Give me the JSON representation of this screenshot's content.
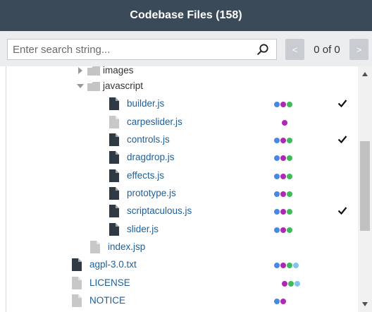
{
  "header": {
    "title": "Codebase Files (158)"
  },
  "search": {
    "placeholder": "Enter search string...",
    "value": "",
    "prev_label": "<",
    "next_label": ">",
    "match_count": "0 of 0"
  },
  "colors": {
    "header_bg": "#3b4a58",
    "blue": "#4a86e8",
    "purple": "#b026b8",
    "green": "#3fba5a",
    "lightblue": "#7ec4ef",
    "file_dark": "#2f3a45",
    "file_light": "#c8c8c8"
  },
  "tree": {
    "rows": [
      {
        "name": "images",
        "kind": "folder",
        "depth": 1,
        "toggle": "collapsed",
        "dots": [],
        "checked": false
      },
      {
        "name": "javascript",
        "kind": "folder",
        "depth": 1,
        "toggle": "expanded",
        "dots": [],
        "checked": false
      },
      {
        "name": "builder.js",
        "kind": "file",
        "depth": 2,
        "icon": "file-dark",
        "dots": [
          "blue",
          "purple",
          "green"
        ],
        "checked": true
      },
      {
        "name": "carpeslider.js",
        "kind": "file",
        "depth": 2,
        "icon": "file-light",
        "dots": [
          "purple"
        ],
        "checked": false
      },
      {
        "name": "controls.js",
        "kind": "file",
        "depth": 2,
        "icon": "file-dark",
        "dots": [
          "blue",
          "purple",
          "green"
        ],
        "checked": true
      },
      {
        "name": "dragdrop.js",
        "kind": "file",
        "depth": 2,
        "icon": "file-dark",
        "dots": [
          "blue",
          "purple",
          "green"
        ],
        "checked": false
      },
      {
        "name": "effects.js",
        "kind": "file",
        "depth": 2,
        "icon": "file-dark",
        "dots": [
          "blue",
          "purple",
          "green"
        ],
        "checked": false
      },
      {
        "name": "prototype.js",
        "kind": "file",
        "depth": 2,
        "icon": "file-dark",
        "dots": [
          "blue",
          "purple",
          "green"
        ],
        "checked": false
      },
      {
        "name": "scriptaculous.js",
        "kind": "file",
        "depth": 2,
        "icon": "file-dark",
        "dots": [
          "blue",
          "purple",
          "green"
        ],
        "checked": true
      },
      {
        "name": "slider.js",
        "kind": "file",
        "depth": 2,
        "icon": "file-dark",
        "dots": [
          "blue",
          "purple",
          "green"
        ],
        "checked": false
      },
      {
        "name": "index.jsp",
        "kind": "file",
        "depth": 1,
        "icon": "file-light",
        "dots": [],
        "checked": false
      },
      {
        "name": "agpl-3.0.txt",
        "kind": "file",
        "depth": 0,
        "icon": "file-dark",
        "dots": [
          "blue",
          "purple",
          "green",
          "lightblue"
        ],
        "checked": false
      },
      {
        "name": "LICENSE",
        "kind": "file",
        "depth": 0,
        "icon": "file-light",
        "dots": [
          "purple",
          "green",
          "lightblue"
        ],
        "checked": false
      },
      {
        "name": "NOTICE",
        "kind": "file",
        "depth": 0,
        "icon": "file-light",
        "dots": [
          "blue",
          "purple"
        ],
        "checked": false
      }
    ]
  }
}
